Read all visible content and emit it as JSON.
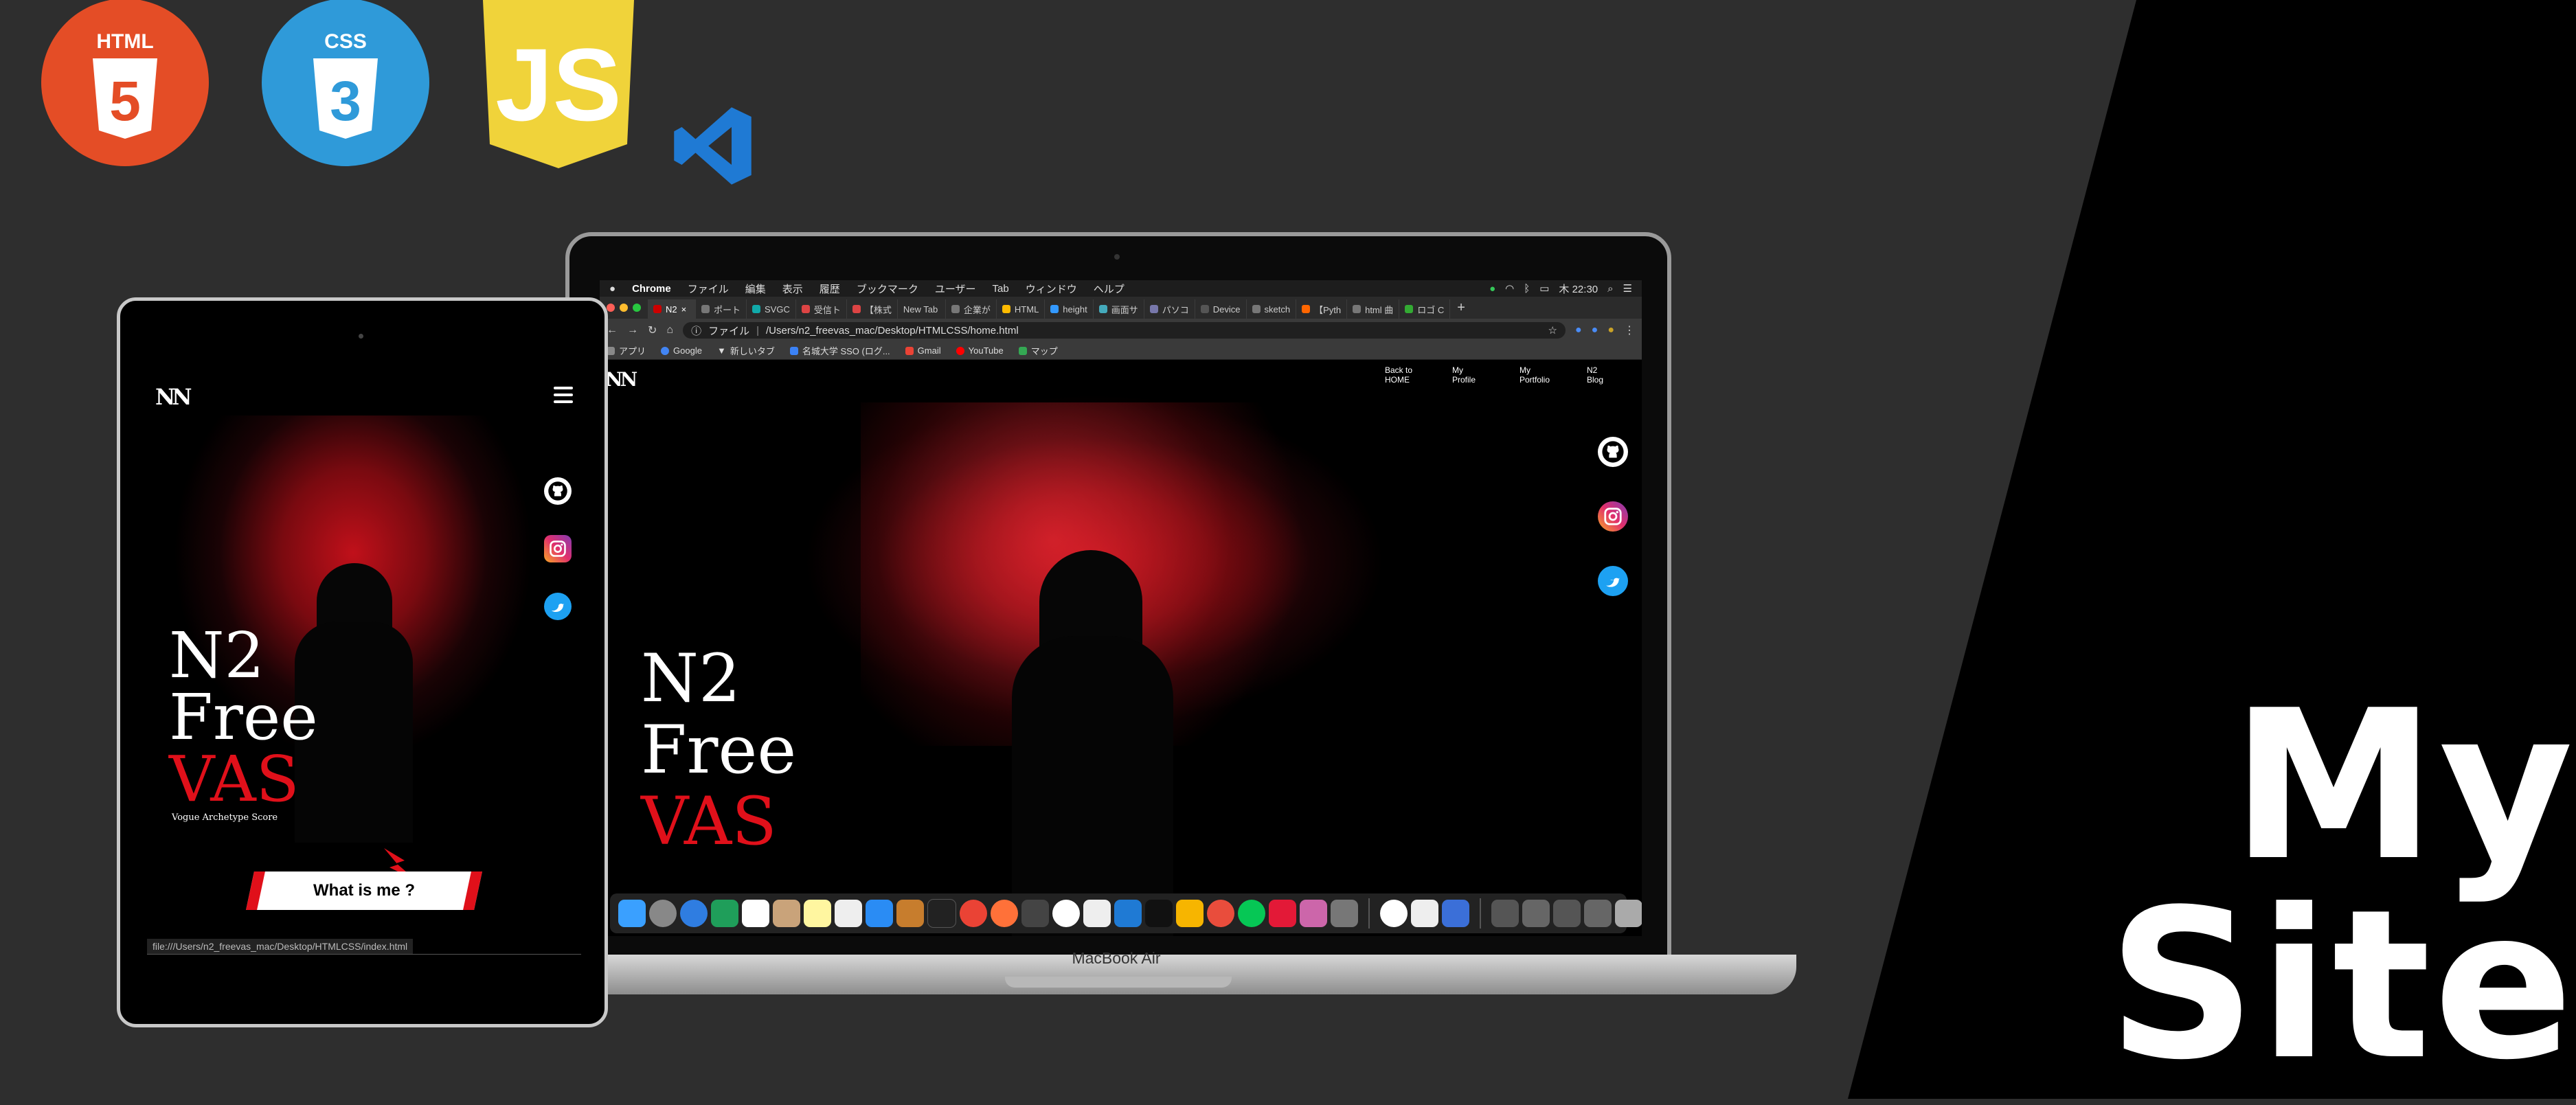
{
  "headline": {
    "line1": "My",
    "line2": "Site"
  },
  "logos": [
    {
      "name": "html5-logo",
      "text": "HTML",
      "num": "5",
      "color": "#e44d26"
    },
    {
      "name": "css3-logo",
      "text": "CSS",
      "num": "3",
      "color": "#2f9ad9"
    },
    {
      "name": "js-logo",
      "text": "JS",
      "color": "#f0d33a"
    },
    {
      "name": "vscode-logo",
      "color": "#1f7ad4"
    }
  ],
  "laptop": {
    "model": "MacBook Air",
    "menubar": {
      "apple": "",
      "app": "Chrome",
      "items": [
        "ファイル",
        "編集",
        "表示",
        "履歴",
        "ブックマーク",
        "ユーザー",
        "Tab",
        "ウィンドウ",
        "ヘルプ"
      ],
      "clock": "木 22:30"
    },
    "tabs": [
      {
        "label": "N2",
        "active": true
      },
      {
        "label": "ポート"
      },
      {
        "label": "SVGC"
      },
      {
        "label": "受信ト"
      },
      {
        "label": "【株式"
      },
      {
        "label": "New Tab"
      },
      {
        "label": "企業が"
      },
      {
        "label": "HTML"
      },
      {
        "label": "height"
      },
      {
        "label": "画面サ"
      },
      {
        "label": "パソコ"
      },
      {
        "label": "Device"
      },
      {
        "label": "sketch"
      },
      {
        "label": "【Pyth"
      },
      {
        "label": "html 曲"
      },
      {
        "label": "ロゴ C"
      }
    ],
    "newtab": "+",
    "address": {
      "scheme": "ファイル",
      "url": "/Users/n2_freevas_mac/Desktop/HTMLCSS/home.html"
    },
    "bookmarks": [
      {
        "label": "アプリ",
        "color": "#aaa"
      },
      {
        "label": "Google",
        "color": "#4285f4"
      },
      {
        "label": "新しいタブ",
        "color": "#ddd"
      },
      {
        "label": "名城大学 SSO (ログ...",
        "color": "#3b82f6"
      },
      {
        "label": "Gmail",
        "color": "#ea4335"
      },
      {
        "label": "YouTube",
        "color": "#ff0000"
      },
      {
        "label": "マップ",
        "color": "#34a853"
      }
    ],
    "site": {
      "logo": "NN",
      "nav": [
        {
          "line1": "Back to",
          "line2": "HOME"
        },
        {
          "line1": "My",
          "line2": "Profile"
        },
        {
          "line1": "My",
          "line2": "Portfolio"
        },
        {
          "line1": "N2",
          "line2": "Blog"
        }
      ],
      "title": {
        "l1": "N2",
        "l2": "Free",
        "l3": "VAS"
      }
    }
  },
  "tablet": {
    "site": {
      "logo": "NN",
      "title": {
        "l1": "N2",
        "l2": "Free",
        "l3": "VAS"
      },
      "tagline": "Vogue Archetype Score",
      "button": "What is me ?"
    },
    "status": "file:///Users/n2_freevas_mac/Desktop/HTMLCSS/index.html"
  }
}
